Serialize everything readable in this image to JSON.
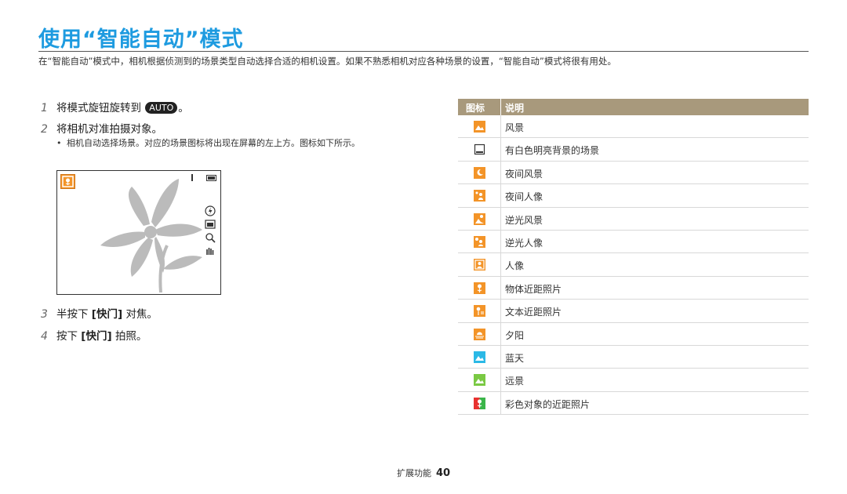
{
  "title": "使用“智能自动”模式",
  "intro": "在“智能自动”模式中，相机根据侦测到的场景类型自动选择合适的相机设置。如果不熟悉相机对应各种场景的设置，“智能自动”模式将很有用处。",
  "steps": [
    {
      "num": "1",
      "pre": "将模式旋钮旋转到",
      "badge": "AUTO",
      "post": "。"
    },
    {
      "num": "2",
      "text": "将相机对准拍摄对象。"
    },
    {
      "num": "3",
      "pre": "半按下",
      "key": "[快门]",
      "post": "对焦。"
    },
    {
      "num": "4",
      "pre": "按下",
      "key": "[快门]",
      "post": "拍照。"
    }
  ],
  "bullet": "相机自动选择场景。对应的场景图标将出现在屏幕的左上方。图标如下所示。",
  "table": {
    "header": {
      "icon": "图标",
      "desc": "说明"
    },
    "rows": [
      {
        "label": "风景",
        "icon": "landscape-icon",
        "color": "#f39428"
      },
      {
        "label": "有白色明亮背景的场景",
        "icon": "white-scene-icon",
        "color": "#ffffff"
      },
      {
        "label": "夜间风景",
        "icon": "night-landscape-icon",
        "color": "#f39428"
      },
      {
        "label": "夜间人像",
        "icon": "night-portrait-icon",
        "color": "#f39428"
      },
      {
        "label": "逆光风景",
        "icon": "backlight-landscape-icon",
        "color": "#f39428"
      },
      {
        "label": "逆光人像",
        "icon": "backlight-portrait-icon",
        "color": "#f39428"
      },
      {
        "label": "人像",
        "icon": "portrait-icon",
        "color": "#f39428"
      },
      {
        "label": "物体近距照片",
        "icon": "macro-object-icon",
        "color": "#f39428"
      },
      {
        "label": "文本近距照片",
        "icon": "macro-text-icon",
        "color": "#f39428"
      },
      {
        "label": "夕阳",
        "icon": "sunset-icon",
        "color": "#f39428"
      },
      {
        "label": "蓝天",
        "icon": "blue-sky-icon",
        "color": "#2bb9e6"
      },
      {
        "label": "远景",
        "icon": "distant-view-icon",
        "color": "#7ac943"
      },
      {
        "label": "彩色对象的近距照片",
        "icon": "color-macro-icon",
        "color": "#e8312f"
      }
    ]
  },
  "footer": {
    "section": "扩展功能",
    "page": "40"
  }
}
